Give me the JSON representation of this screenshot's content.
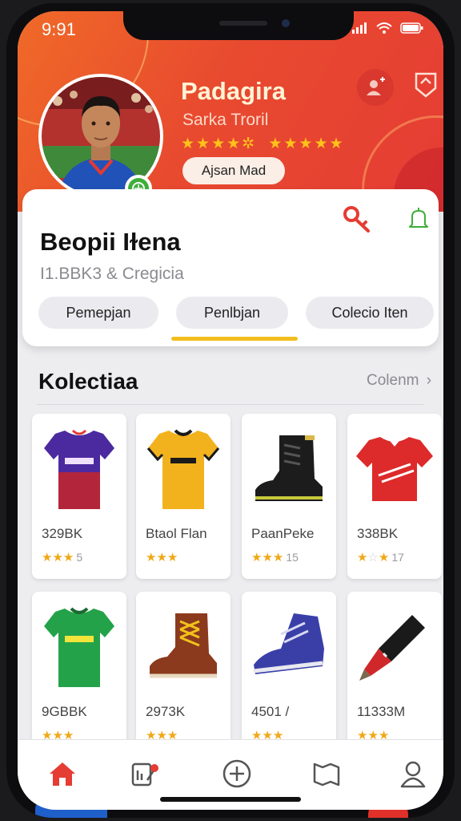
{
  "status_bar": {
    "time": "9:91"
  },
  "profile": {
    "name": "Padagira",
    "subtitle": "Sarka Troril",
    "stars_left": "★★★★✲",
    "stars_right": "★★★★★",
    "action_label": "Ajsan Mad"
  },
  "card": {
    "title": "Beopii Iɫena",
    "subtitle": "I1.BBK3 & Cregicia",
    "tabs": [
      {
        "label": "Pemepjan"
      },
      {
        "label": "Penlbjan"
      },
      {
        "label": "Colecio Iten"
      }
    ]
  },
  "collection": {
    "title": "Kolectiaa",
    "link_label": "Colenm",
    "items": [
      {
        "price": "329BK",
        "rating_count": "5",
        "image": "purple-jersey"
      },
      {
        "price": "Btaol Flan",
        "rating_count": "",
        "image": "yellow-jersey"
      },
      {
        "price": "PaanPeke",
        "rating_count": "15",
        "image": "black-boot"
      },
      {
        "price": "338BK",
        "rating_count": "17",
        "image": "red-jersey"
      },
      {
        "price": "9GBBK",
        "rating_count": "",
        "image": "green-jersey"
      },
      {
        "price": "2973K",
        "rating_count": "",
        "image": "brown-boot"
      },
      {
        "price": "4501 /",
        "rating_count": "",
        "image": "blue-sneaker"
      },
      {
        "price": "11333M",
        "rating_count": "",
        "image": "marker-pen"
      }
    ]
  },
  "nav": [
    {
      "icon": "home-icon",
      "active": true
    },
    {
      "icon": "collection-icon",
      "active": false
    },
    {
      "icon": "add-icon",
      "active": false
    },
    {
      "icon": "map-icon",
      "active": false
    },
    {
      "icon": "profile-icon",
      "active": false
    }
  ],
  "colors": {
    "accent": "#e84a2f",
    "star": "#f0a818",
    "tab_indicator": "#f2be1e"
  }
}
